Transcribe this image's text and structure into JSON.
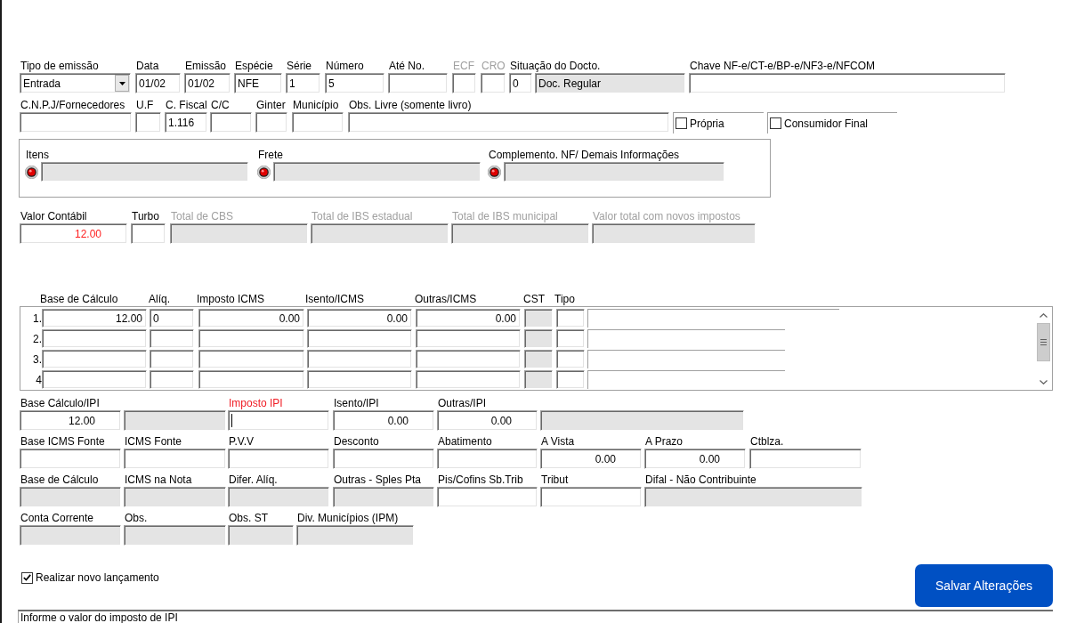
{
  "header_row": [
    {
      "kind": "dropdown",
      "label": "Tipo de emissão",
      "value": "Entrada",
      "disabled": false,
      "readonly": false
    },
    {
      "kind": "text",
      "label": "Data",
      "value": "01/02",
      "disabled": false,
      "readonly": false
    },
    {
      "kind": "text",
      "label": "Emissão",
      "value": "01/02",
      "disabled": false,
      "readonly": false
    },
    {
      "kind": "text",
      "label": "Espécie",
      "value": "NFE",
      "disabled": false,
      "readonly": false
    },
    {
      "kind": "text",
      "label": "Série",
      "value": "1",
      "disabled": false,
      "readonly": false
    },
    {
      "kind": "text",
      "label": "Número",
      "value": "5",
      "disabled": false,
      "readonly": false
    },
    {
      "kind": "text",
      "label": "Até No.",
      "disabled": false,
      "readonly": false
    },
    {
      "kind": "text",
      "label": "ECF",
      "disabled": true,
      "readonly": false
    },
    {
      "kind": "text",
      "label": "CRO",
      "disabled": true,
      "readonly": false
    },
    {
      "kind": "text",
      "label": "Situação do Docto.",
      "value": "0",
      "disabled": false,
      "readonly": false
    },
    {
      "kind": "text",
      "value": "Doc. Regular",
      "disabled": false,
      "readonly": true
    },
    {
      "kind": "text",
      "label": "Chave NF-e/CT-e/BP-e/NF3-e/NFCOM",
      "disabled": false,
      "readonly": false
    }
  ],
  "supplier_row": [
    {
      "kind": "text",
      "label": "C.N.P.J/Fornecedores",
      "readonly": false
    },
    {
      "kind": "text",
      "label": "U.F",
      "readonly": false
    },
    {
      "kind": "text",
      "label": "C. Fiscal",
      "value": "1.116",
      "readonly": false
    },
    {
      "kind": "text",
      "label": "C/C",
      "readonly": false
    },
    {
      "kind": "text",
      "label": "Ginter",
      "readonly": false
    },
    {
      "kind": "text",
      "label": "Município",
      "readonly": false
    },
    {
      "kind": "text",
      "label": "Obs. Livre (somente livro)",
      "readonly": false
    },
    {
      "kind": "checkbox",
      "label": "Própria",
      "checked": false
    },
    {
      "kind": "checkbox",
      "label": "Consumidor Final",
      "checked": false
    }
  ],
  "references": {
    "items": [
      {
        "label": "Itens",
        "readonly": true
      },
      {
        "label": "Frete",
        "readonly": true
      },
      {
        "label": "Complemento. NF/ Demais Informações",
        "readonly": true
      }
    ]
  },
  "totals_row": [
    {
      "label": "Valor Contábil",
      "value": "12.00",
      "highlighted": true,
      "disabled": false,
      "readonly": false
    },
    {
      "label": "Turbo",
      "disabled": false,
      "readonly": false
    },
    {
      "label": "Total de CBS",
      "disabled": true,
      "readonly": true
    },
    {
      "label": "Total de IBS estadual",
      "disabled": true,
      "readonly": true
    },
    {
      "label": "Total de IBS municipal",
      "disabled": true,
      "readonly": true
    },
    {
      "label": "Valor total com novos impostos",
      "disabled": true,
      "readonly": true
    }
  ],
  "icms_grid": {
    "columns": [
      {
        "label": "Base de Cálculo",
        "readonly": false
      },
      {
        "label": "Alíq.",
        "readonly": false
      },
      {
        "label": "Imposto ICMS",
        "readonly": false
      },
      {
        "label": "Isento/ICMS",
        "readonly": false
      },
      {
        "label": "Outras/ICMS",
        "readonly": false
      },
      {
        "label": "CST",
        "readonly": true
      },
      {
        "label": "Tipo",
        "readonly": false
      }
    ],
    "rows": [
      {
        "number": "1.",
        "cells": [
          "12.00",
          "0",
          "0.00",
          "0.00",
          "0.00"
        ]
      },
      {
        "number": "2."
      },
      {
        "number": "3."
      },
      {
        "number": "4"
      }
    ]
  },
  "ipi_row": [
    {
      "label": "Base Cálculo/IPI",
      "value": "12.00",
      "readonly": false,
      "focused": false
    },
    {
      "readonly": true,
      "focused": false
    },
    {
      "label": "Imposto IPI",
      "readonly": false,
      "focused": true
    },
    {
      "label": "Isento/IPI",
      "value": "0.00",
      "readonly": false,
      "focused": false
    },
    {
      "label": "Outras/IPI",
      "value": "0.00",
      "readonly": false,
      "focused": false
    },
    {
      "readonly": true,
      "focused": false
    }
  ],
  "source_row": [
    {
      "label": "Base ICMS Fonte",
      "readonly": false
    },
    {
      "label": "ICMS Fonte",
      "readonly": false
    },
    {
      "label": "P.V.V",
      "readonly": false
    },
    {
      "label": "Desconto",
      "readonly": false
    },
    {
      "label": "Abatimento",
      "readonly": false
    },
    {
      "label": "A Vista",
      "value": "0.00",
      "readonly": false
    },
    {
      "label": "A Prazo",
      "value": "0.00",
      "readonly": false
    },
    {
      "label": "Ctblza.",
      "readonly": false
    }
  ],
  "calc_row": [
    {
      "label": "Base de Cálculo",
      "readonly": true
    },
    {
      "label": "ICMS na Nota",
      "readonly": true
    },
    {
      "label": "Difer. Alíq.",
      "readonly": true
    },
    {
      "label": "Outras - Sples Pta",
      "readonly": true
    },
    {
      "label": "Pis/Cofins Sb.Trib",
      "readonly": false
    },
    {
      "label": "Tribut",
      "readonly": false
    },
    {
      "label": "Difal - Não Contribuinte",
      "readonly": true
    }
  ],
  "accounts_row": [
    {
      "label": "Conta Corrente",
      "readonly": true
    },
    {
      "label": "Obs.",
      "readonly": true
    },
    {
      "label": "Obs. ST",
      "readonly": true
    },
    {
      "label": "Div. Municípios (IPM)",
      "readonly": true
    }
  ],
  "new_entry": {
    "label": "Realizar novo lançamento",
    "checked": true
  },
  "save_button": {
    "label": "Salvar Alterações"
  },
  "status_bar": {
    "text": "Informe o valor do imposto de IPI"
  }
}
